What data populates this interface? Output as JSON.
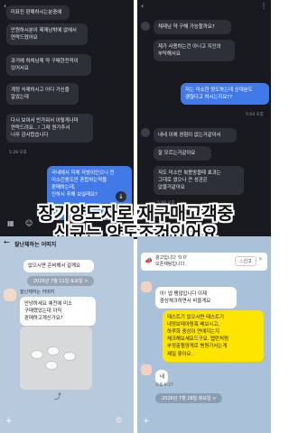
{
  "left_top": {
    "messages": [
      "미표진 판매하시는분중에",
      "안원하시분이 제재남밖에 없에서\n연락드렸어요",
      "과거에 하쳐님께 약 구매한전적이\n있어서요",
      "계정 식제하시고 어디 가신줄\n알았는데",
      "다시 보여서 반가워서 이렇게나마\n연락드려요...! 그래 뭔가추서\n너무 감사합습니다"
    ],
    "time": "5:28 오후",
    "reply": "국내에서 미체 자방이인으니 전\n미소긴동도안 흔합하는약을\n판매하는데,\n인하시 추해 보실래요?"
  },
  "right_top": {
    "messages_in": [
      "채제님 약 구해 가능할까요?",
      "제가 사용하는건 아니고 지인의\n부탁해서요"
    ],
    "reply1": "저는 미소한 양도하는데 상대분도\n괜찮다고 하시는지요??",
    "time1": "5:04 오후",
    "messages_in2": [
      "네네 이에 경험이 없는거같아서",
      "잘 모르는거같아요",
      "저도 미소만 복용방을때 효과는\n그대로 였으나 큰 성관은\n없을거같아요"
    ],
    "time2": "5:06 오후"
  },
  "caption_lines": [
    "장기양도자로 재구매고객중",
    "신규는 양도조건있어요"
  ],
  "left_bottom": {
    "title": "잘난체하는 어떠지",
    "msg1": "없으시면 준비해서 갈께요",
    "date": "2026년 7월 11일 토요일 >",
    "sender": "잘난체하는 어떠지",
    "msg2": "안녕하세요 예전에 미소\n구매했었는데 아직\n판매하고계신가요?"
  },
  "right_bottom": {
    "notice": "광고입니다 '0 0'\n오픈채팅입니다.",
    "alert_button": "신고",
    "msg1": "아! 넵 팸않입니다 이제\n중상체크하면서 비울게요",
    "msg2": "테스트기 있으시면 테스트기\n내정보테아링혹 베보시고,\n하루화 중상이 연애지는지\n체크해보세요드구요. 탭란처럼\n부정출혈양게로 병원가서는게\n제일 좋아요.",
    "reply": "네",
    "time": "오후 6:27",
    "date": "2026년 7월 28일 화요일 >"
  }
}
